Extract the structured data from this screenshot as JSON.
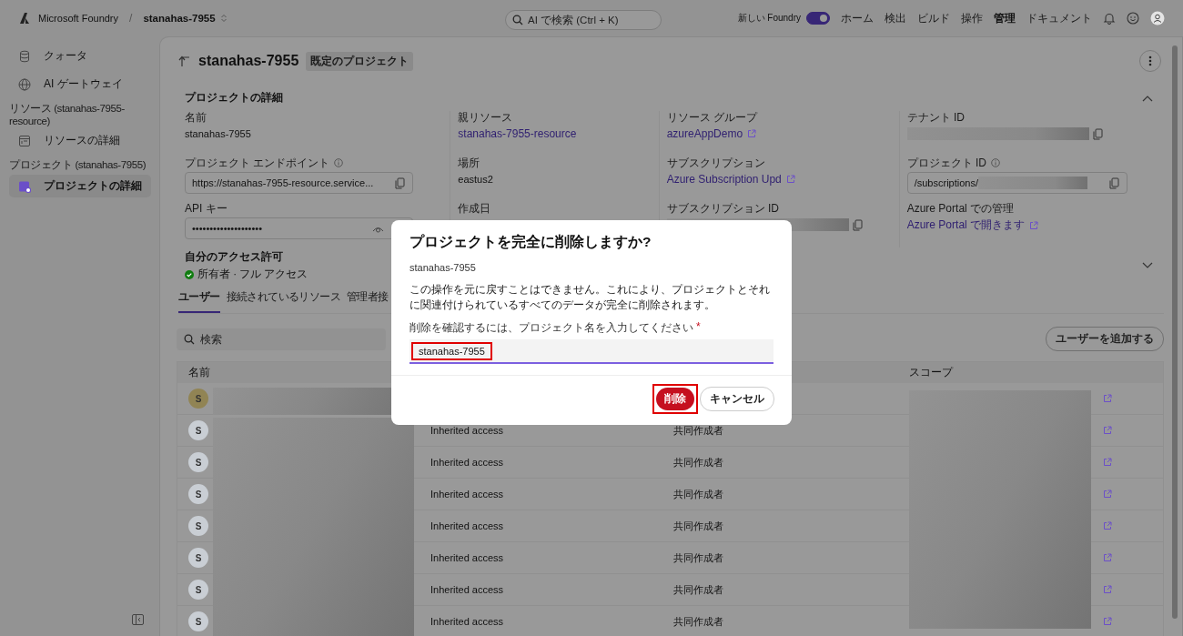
{
  "topbar": {
    "brand": "Microsoft Foundry",
    "separator": "/",
    "project": "stanahas-7955",
    "search": {
      "placeholder": "AI で検索 (Ctrl + K)"
    },
    "toggle": {
      "label": "新しい Foundry",
      "on": true
    },
    "nav": [
      {
        "label": "ホーム",
        "selected": false
      },
      {
        "label": "検出",
        "selected": false
      },
      {
        "label": "ビルド",
        "selected": false
      },
      {
        "label": "操作",
        "selected": false
      },
      {
        "label": "管理",
        "selected": true
      },
      {
        "label": "ドキュメント",
        "selected": false
      }
    ]
  },
  "sidebar": {
    "entries": [
      {
        "kind": "item",
        "label": "クォータ",
        "selected": false
      },
      {
        "kind": "item",
        "label": "AI ゲートウェイ",
        "selected": false
      },
      {
        "kind": "heading",
        "label": "リソース (stanahas-7955-resource)"
      },
      {
        "kind": "item",
        "label": "リソースの詳細",
        "selected": false
      },
      {
        "kind": "heading",
        "label": "プロジェクト (stanahas-7955)"
      },
      {
        "kind": "item",
        "label": "プロジェクトの詳細",
        "selected": true
      }
    ]
  },
  "page": {
    "title": "stanahas-7955",
    "badge": "既定のプロジェクト"
  },
  "details": {
    "title": "プロジェクトの詳細",
    "expanded": true,
    "columns": [
      [
        {
          "kind": "text",
          "label": "名前",
          "value": "stanahas-7955"
        },
        {
          "kind": "input",
          "label": "プロジェクト エンドポイント",
          "info": true,
          "value": "https://stanahas-7955-resource.service...",
          "reveal": false,
          "redacted": false
        },
        {
          "kind": "input",
          "label": "API キー",
          "info": false,
          "value": "••••••••••••••••••••",
          "reveal": true,
          "redacted": false
        }
      ],
      [
        {
          "kind": "link",
          "label": "親リソース",
          "value": "stanahas-7955-resource",
          "external": false
        },
        {
          "kind": "text",
          "label": "場所",
          "value": "eastus2"
        },
        {
          "kind": "label",
          "label": "作成日"
        }
      ],
      [
        {
          "kind": "link",
          "label": "リソース グループ",
          "value": "azureAppDemo",
          "external": true
        },
        {
          "kind": "link",
          "label": "サブスクリプション",
          "value": "Azure Subscription Upd",
          "external": true
        },
        {
          "kind": "redacted",
          "label": "サブスクリプション ID"
        }
      ],
      [
        {
          "kind": "redacted",
          "label": "テナント ID"
        },
        {
          "kind": "input",
          "label": "プロジェクト ID",
          "info": true,
          "value": "/subscriptions/",
          "reveal": false,
          "redacted": true
        },
        {
          "kind": "link",
          "label": "Azure Portal での管理",
          "value": "Azure Portal で開きます",
          "external": true
        }
      ]
    ]
  },
  "access": {
    "title": "自分のアクセス許可",
    "status": "所有者 · フル アクセス",
    "expanded": false
  },
  "tabs": [
    {
      "label": "ユーザー",
      "selected": true
    },
    {
      "label": "接続されているリソース",
      "selected": false
    },
    {
      "label": "管理者接",
      "selected": false
    }
  ],
  "users": {
    "search": {
      "placeholder": "検索"
    },
    "add_button": "ユーザーを追加する",
    "name_header": "名前",
    "scope_header": "スコープ",
    "rows": [
      {
        "avatar": "S",
        "color": "#918454"
      },
      {
        "avatar": "S",
        "color": "#c9ced4",
        "access": "Inherited access",
        "role": "共同作成者"
      },
      {
        "avatar": "S",
        "color": "#c9ced4",
        "access": "Inherited access",
        "role": "共同作成者"
      },
      {
        "avatar": "S",
        "color": "#c9ced4",
        "access": "Inherited access",
        "role": "共同作成者"
      },
      {
        "avatar": "S",
        "color": "#c9ced4",
        "access": "Inherited access",
        "role": "共同作成者"
      },
      {
        "avatar": "S",
        "color": "#c9ced4",
        "access": "Inherited access",
        "role": "共同作成者"
      },
      {
        "avatar": "S",
        "color": "#c9ced4",
        "access": "Inherited access",
        "role": "共同作成者"
      },
      {
        "avatar": "S",
        "color": "#c9ced4",
        "access": "Inherited access",
        "role": "共同作成者"
      }
    ]
  },
  "dialog": {
    "title": "プロジェクトを完全に削除しますか?",
    "subtitle": "stanahas-7955",
    "message": "この操作を元に戻すことはできません。これにより、プロジェクトとそれに関連付けられているすべてのデータが完全に削除されます。",
    "field": {
      "label": "削除を確認するには、プロジェクト名を入力してください",
      "required_mark": "*",
      "value": "stanahas-7955",
      "highlighted": true
    },
    "confirm": {
      "label": "削除",
      "highlighted": true
    },
    "cancel": "キャンセル"
  }
}
